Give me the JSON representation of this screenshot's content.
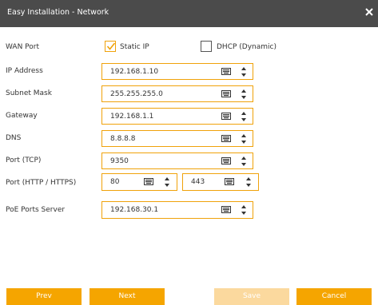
{
  "window": {
    "title": "Easy Installation - Network"
  },
  "wan_port": {
    "label": "WAN Port",
    "static": {
      "label": "Static IP",
      "checked": true
    },
    "dhcp": {
      "label": "DHCP (Dynamic)",
      "checked": false
    }
  },
  "fields": {
    "ip_address": {
      "label": "IP Address",
      "value": "192.168.1.10"
    },
    "subnet_mask": {
      "label": "Subnet Mask",
      "value": "255.255.255.0"
    },
    "gateway": {
      "label": "Gateway",
      "value": "192.168.1.1"
    },
    "dns": {
      "label": "DNS",
      "value": "8.8.8.8"
    },
    "port_tcp": {
      "label": "Port (TCP)",
      "value": "9350"
    },
    "port_http": {
      "label": "Port (HTTP / HTTPS)",
      "http_value": "80",
      "https_value": "443"
    },
    "poe_server": {
      "label": "PoE Ports Server",
      "value": "192.168.30.1"
    }
  },
  "buttons": {
    "prev": "Prev",
    "next": "Next",
    "save": "Save",
    "cancel": "Cancel"
  },
  "colors": {
    "accent": "#f5a500",
    "titlebar": "#4b4b4b",
    "disabled": "#fbd99e"
  },
  "icons": {
    "close": "close-icon",
    "keyboard": "keyboard-icon",
    "spinner": "spinner-icon",
    "checkmark": "checkmark-icon"
  }
}
